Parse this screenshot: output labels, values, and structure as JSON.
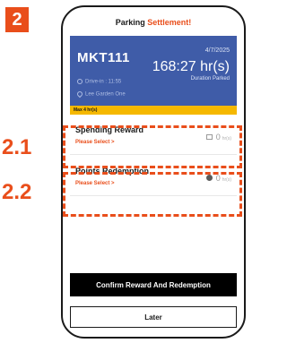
{
  "step_badge": "2",
  "annotations": {
    "a1": "2.1",
    "a2": "2.2"
  },
  "header": {
    "title_main": "Parking ",
    "title_accent": "Settlement!"
  },
  "parking": {
    "plate": "MKT111",
    "date": "4/7/2025",
    "duration": "168:27 hr(s)",
    "duration_label": "Duration Parked",
    "drive_in": "Drive-in : 11:55",
    "location": "Lee Garden One"
  },
  "max_strip": "Max 4 hr(s)",
  "rows": [
    {
      "title": "Spending Reward",
      "select": "Please Select >",
      "value": "0",
      "unit": "hr(s)",
      "icon": "ticket-icon"
    },
    {
      "title": "Points Redemption",
      "select": "Please Select >",
      "value": "0",
      "unit": "hr(s)",
      "icon": "coin-icon"
    }
  ],
  "buttons": {
    "confirm": "Confirm Reward And Redemption",
    "later": "Later"
  },
  "colors": {
    "accent": "#e94e1b",
    "card": "#3f5ca8",
    "strip": "#f5b800"
  }
}
